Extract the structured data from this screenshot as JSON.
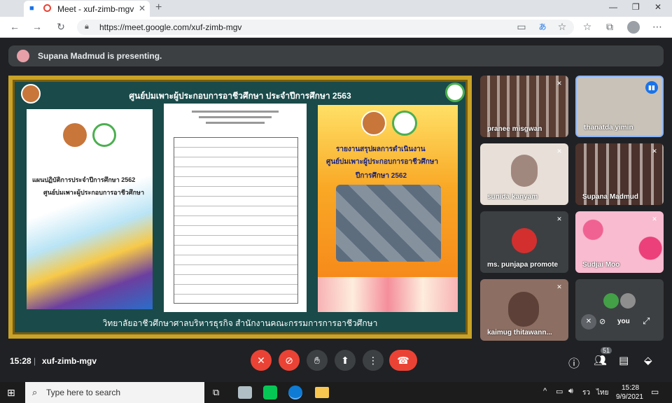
{
  "browser": {
    "tab_title": "Meet - xuf-zimb-mgv",
    "new_tab": "+",
    "url": "https://meet.google.com/xuf-zimb-mgv"
  },
  "presenting": {
    "text": "Supana Madmud is presenting."
  },
  "slide": {
    "header": "ศูนย์บ่มเพาะผู้ประกอบการอาชีวศึกษา  ประจำปีการศึกษา 2563",
    "footer": "วิทยาลัยอาชีวศึกษาศาลบริหารธุรกิจ   สำนักงานคณะกรรมการการอาชีวศึกษา",
    "left_cover_line1": "แผนปฏิบัติการประจำปีการศึกษา 2562",
    "left_cover_line2": "ศูนย์บ่มเพาะผู้ประกอบการอาชีวศึกษา",
    "right_cover_line1": "รายงานสรุปผลการดำเนินงาน",
    "right_cover_line2": "ศูนย์บ่มเพาะผู้ประกอบการอาชีวศึกษา",
    "right_cover_line3": "ปีการศึกษา  2562"
  },
  "participants": [
    {
      "name": "pranee misgwan",
      "muted": true
    },
    {
      "name": "thanatda yimin",
      "muted": false,
      "speaking": true
    },
    {
      "name": "sunida kanyam",
      "muted": true
    },
    {
      "name": "Supana Madmud",
      "muted": true
    },
    {
      "name": "ms. punjapa promote",
      "muted": true
    },
    {
      "name": "Sudjai Moo",
      "muted": true
    },
    {
      "name": "kaimug thitawann...",
      "muted": true
    },
    {
      "name": "you",
      "muted": true
    }
  ],
  "meeting": {
    "time": "15:28",
    "separator": "|",
    "code": "xuf-zimb-mgv",
    "participant_count": "51"
  },
  "taskbar": {
    "search_placeholder": "Type here to search",
    "language": "ไทย",
    "clock_time": "15:28",
    "clock_date": "9/9/2021"
  },
  "colors": {
    "meet_bg": "#202124",
    "end_call": "#ea4335",
    "active_speaker": "#8ab4f8"
  }
}
